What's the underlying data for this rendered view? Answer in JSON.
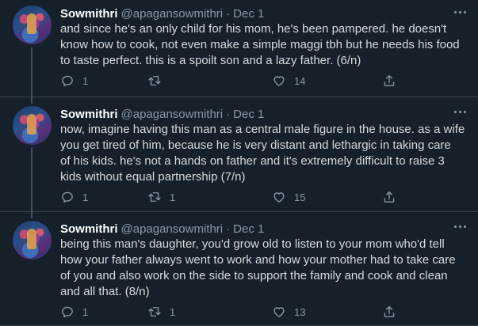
{
  "tweets": [
    {
      "name": "Sowmithri",
      "handle": "@apagansowmithri",
      "sep": "·",
      "date": "Dec 1",
      "lines": [
        "and since he's an only child for his mom, he's been pampered. he doesn't",
        "know how to cook, not even make a simple maggi tbh but he needs his food",
        "to taste perfect. this is a spoilt son and a lazy father. (6/n)"
      ],
      "replies": "1",
      "retweets": "",
      "likes": "14"
    },
    {
      "name": "Sowmithri",
      "handle": "@apagansowmithri",
      "sep": "·",
      "date": "Dec 1",
      "lines": [
        "now, imagine having this man as a central male figure in the house. as a wife",
        "you get tired of him, because he is very distant and lethargic in taking care",
        "of his kids. he's not a hands on father and it's extremely difficult to raise 3",
        "kids without equal partnership (7/n)"
      ],
      "replies": "1",
      "retweets": "1",
      "likes": "15"
    },
    {
      "name": "Sowmithri",
      "handle": "@apagansowmithri",
      "sep": "·",
      "date": "Dec 1",
      "lines": [
        "being this man's daughter, you'd grow old to listen to your mom who'd tell",
        "how your father always went to work and how your mother had to take care",
        "of you and also work on the side to support the family and cook and clean",
        "and all that. (8/n)"
      ],
      "replies": "1",
      "retweets": "1",
      "likes": "13"
    }
  ],
  "colors": {
    "background": "#15202b",
    "text": "#d9d9d9",
    "secondary": "#8899a6",
    "divider": "#38444d"
  },
  "icons": [
    "reply-icon",
    "retweet-icon",
    "like-icon",
    "share-icon",
    "more-icon"
  ]
}
